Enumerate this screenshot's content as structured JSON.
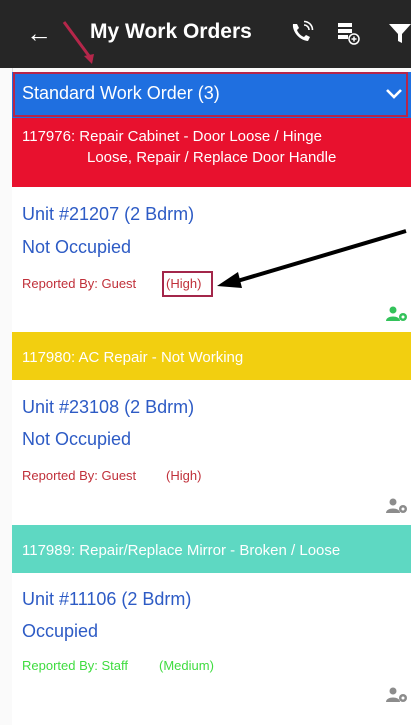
{
  "topbar": {
    "title": "My Work Orders"
  },
  "group": {
    "label": "Standard Work Order (3)"
  },
  "orders": [
    {
      "header_line1": "117976:  Repair Cabinet - Door Loose / Hinge",
      "header_line2": "Loose, Repair / Replace Door Handle",
      "unit": "Unit #21207 (2 Bdrm)",
      "occupancy": "Not Occupied",
      "reported": "Reported By: Guest",
      "priority": "(High)",
      "header_color": "#e8112e",
      "priority_color": "#c0303a"
    },
    {
      "header_line1": "117980:  AC Repair - Not Working",
      "unit": "Unit #23108 (2 Bdrm)",
      "occupancy": "Not Occupied",
      "reported": "Reported By: Guest",
      "priority": "(High)",
      "header_color": "#f2cf10",
      "priority_color": "#c0303a"
    },
    {
      "header_line1": "117989:  Repair/Replace Mirror - Broken / Loose",
      "unit": "Unit #11106 (2 Bdrm)",
      "occupancy": "Occupied",
      "reported": "Reported By: Staff",
      "priority": "(Medium)",
      "header_color": "#5ed8c2",
      "priority_color": "#3fdc3f"
    }
  ],
  "icons": [
    "back-arrow-icon",
    "phone-icon",
    "filter-list-icon",
    "filter-icon",
    "chevron-down-icon",
    "person-icon"
  ]
}
